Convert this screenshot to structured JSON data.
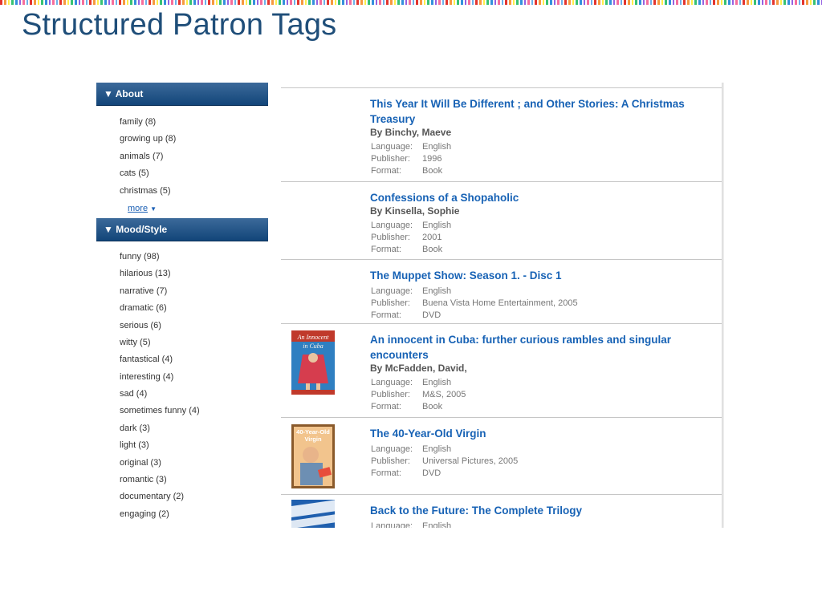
{
  "slide": {
    "title": "Structured Patron Tags"
  },
  "sidebar": {
    "about": {
      "header": "▼ About",
      "tags": [
        "family (8)",
        "growing up (8)",
        "animals (7)",
        "cats (5)",
        "christmas (5)"
      ],
      "more_label": "more",
      "more_icon": "chevron-down-icon"
    },
    "mood": {
      "header": "▼ Mood/Style",
      "tags": [
        "funny (98)",
        "hilarious (13)",
        "narrative (7)",
        "dramatic (6)",
        "serious (6)",
        "witty (5)",
        "fantastical (4)",
        "interesting (4)",
        "sad (4)",
        "sometimes funny (4)",
        "dark (3)",
        "light (3)",
        "original (3)",
        "romantic (3)",
        "documentary (2)",
        "engaging (2)"
      ]
    }
  },
  "labels": {
    "language": "Language:",
    "publisher": "Publisher:",
    "format": "Format:"
  },
  "results": [
    {
      "title": "This Year It Will Be Different ; and Other Stories: A Christmas Treasury",
      "author": "By Binchy, Maeve",
      "language": "English",
      "publisher": "1996",
      "format": "Book",
      "thumb": null
    },
    {
      "title": "Confessions of a Shopaholic",
      "author": "By Kinsella, Sophie",
      "language": "English",
      "publisher": "2001",
      "format": "Book",
      "thumb": null
    },
    {
      "title": "The Muppet Show: Season 1. - Disc 1",
      "author": null,
      "language": "English",
      "publisher": "Buena Vista Home Entertainment, 2005",
      "format": "DVD",
      "thumb": null
    },
    {
      "title": "An innocent in Cuba: further curious rambles and singular encounters",
      "author": "By McFadden, David,",
      "language": "English",
      "publisher": "M&S, 2005",
      "format": "Book",
      "thumb": {
        "kind": "book-cover-cuba",
        "text": "An Innocent in Cuba"
      }
    },
    {
      "title": "The 40-Year-Old Virgin",
      "author": null,
      "language": "English",
      "publisher": "Universal Pictures, 2005",
      "format": "DVD",
      "thumb": {
        "kind": "dvd-cover-40-year-old-virgin",
        "text": "40-Year-Old Virgin"
      }
    },
    {
      "title": "Back to the Future: The Complete Trilogy",
      "author": null,
      "language": "English",
      "publisher": null,
      "format": null,
      "thumb": {
        "kind": "dvd-cover-back-to-the-future",
        "text": null
      }
    }
  ]
}
